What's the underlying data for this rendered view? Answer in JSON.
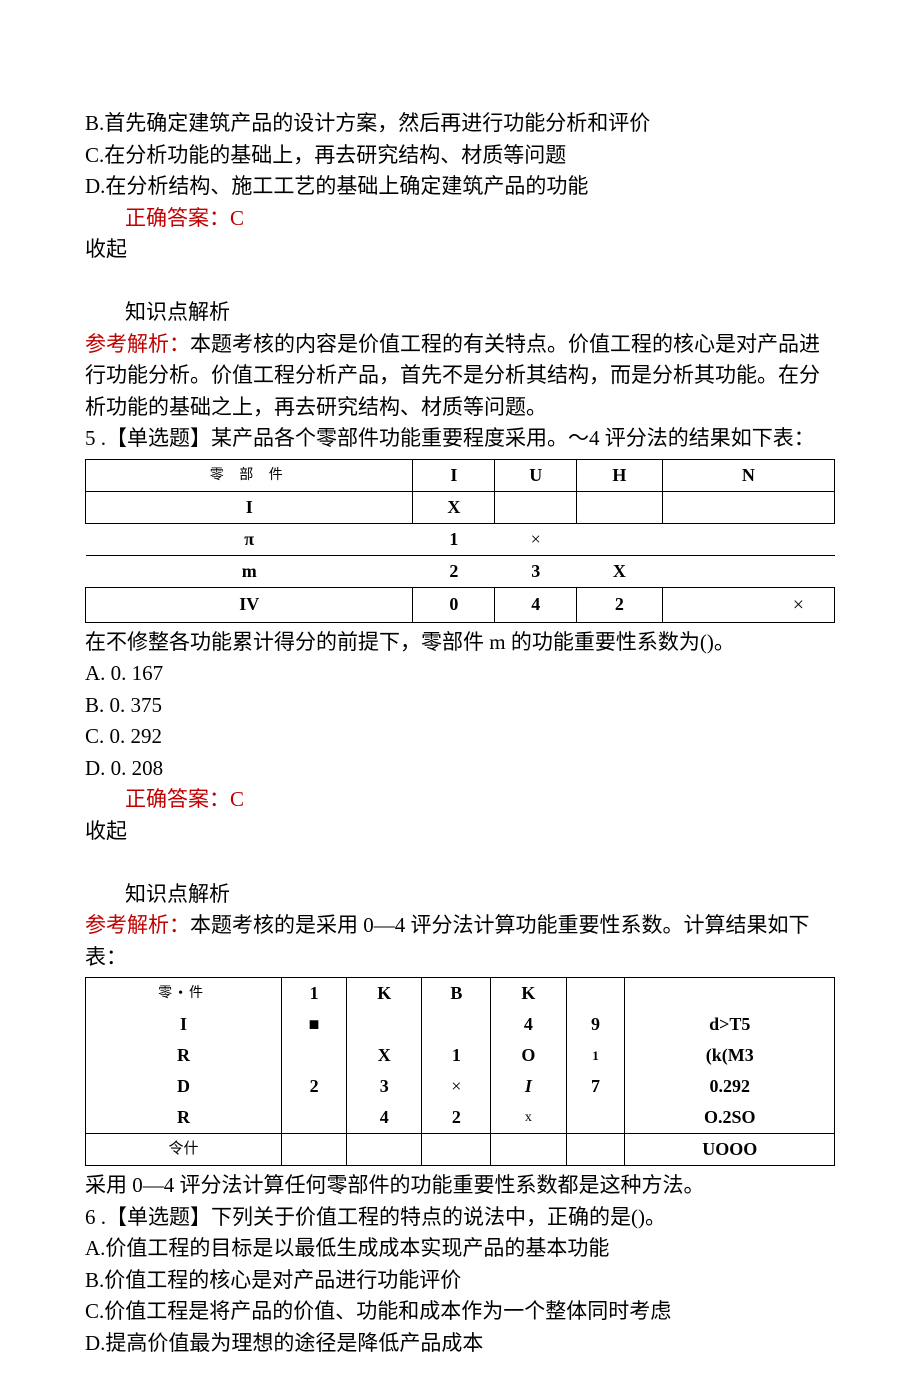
{
  "q4": {
    "optB": "B.首先确定建筑产品的设计方案，然后再进行功能分析和评价",
    "optC": "C.在分析功能的基础上，再去研究结构、材质等问题",
    "optD": "D.在分析结构、施工工艺的基础上确定建筑产品的功能",
    "ans_label": "正确答案：",
    "ans": "C",
    "collapse": "收起",
    "knowledge": "知识点解析",
    "ref_label": "参考解析：",
    "ref_body": "本题考核的内容是价值工程的有关特点。价值工程的核心是对产品进行功能分析。价值工程分析产品，首先不是分析其结构，而是分析其功能。在分析功能的基础之上，再去研究结构、材质等问题。"
  },
  "q5": {
    "stem": "5 .【单选题】某产品各个零部件功能重要程度采用。～4 评分法的结果如下表：",
    "table_header": [
      "零 部 件",
      "I",
      "U",
      "H",
      "N"
    ],
    "rows": [
      [
        "I",
        "X",
        "",
        "",
        ""
      ],
      [
        "π",
        "1",
        "×",
        "",
        ""
      ],
      [
        "m",
        "2",
        "3",
        "X",
        ""
      ],
      [
        "IV",
        "0",
        "4",
        "2",
        "×"
      ]
    ],
    "post_table": "在不修整各功能累计得分的前提下，零部件 m 的功能重要性系数为()。",
    "optA": "A.  0. 167",
    "optB": "B.  0. 375",
    "optC": "C.  0. 292",
    "optD": "D.  0. 208",
    "ans_label": "正确答案：",
    "ans": "C",
    "collapse": "收起",
    "knowledge": "知识点解析",
    "ref_label": "参考解析：",
    "ref_body": "本题考核的是采用 0—4 评分法计算功能重要性系数。计算结果如下表：",
    "t2_header": [
      "零•件",
      "1",
      "K",
      "B",
      "K",
      "",
      ""
    ],
    "t2_rows": [
      [
        "I",
        "■",
        "",
        "",
        "4",
        "9",
        "d>T5"
      ],
      [
        "R",
        "",
        "X",
        "1",
        "O",
        "1",
        "(k(M3"
      ],
      [
        "D",
        "2",
        "3",
        "×",
        "I",
        "7",
        "0.292"
      ],
      [
        "R",
        "",
        "4",
        "2",
        "x",
        "",
        "O.2SO"
      ],
      [
        "令什",
        "",
        "",
        "",
        "",
        "",
        "UOOO"
      ]
    ],
    "post_t2": "采用 0—4 评分法计算任何零部件的功能重要性系数都是这种方法。"
  },
  "q6": {
    "stem": "6 .【单选题】下列关于价值工程的特点的说法中，正确的是()。",
    "optA": "A.价值工程的目标是以最低生成成本实现产品的基本功能",
    "optB": "B.价值工程的核心是对产品进行功能评价",
    "optC": "C.价值工程是将产品的价值、功能和成本作为一个整体同时考虑",
    "optD": "D.提高价值最为理想的途径是降低产品成本"
  }
}
